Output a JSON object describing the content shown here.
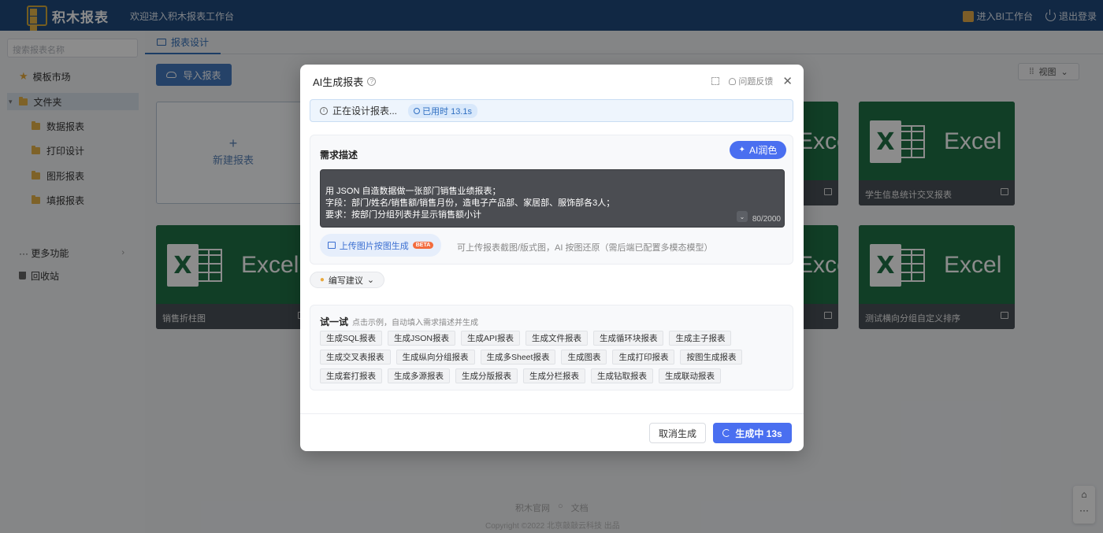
{
  "header": {
    "logo_text": "积木报表",
    "welcome": "欢迎进入积木报表工作台",
    "bi_link": "进入BI工作台",
    "logout": "退出登录"
  },
  "sidebar": {
    "search_placeholder": "搜索报表名称",
    "template_market": "模板市场",
    "folder": "文件夹",
    "sub_items": [
      "数据报表",
      "打印设计",
      "图形报表",
      "填报报表"
    ],
    "more": "··· 更多功能",
    "recycle": "回收站"
  },
  "main": {
    "tab": "报表设计",
    "import_btn": "导入报表",
    "view_btn": "视图",
    "new_card": "新建报表",
    "excel_word": "Excel",
    "cards": [
      {
        "title": ""
      },
      {
        "title": "学生信息统计交叉报表"
      },
      {
        "title": "销售折柱图"
      },
      {
        "title": ""
      },
      {
        "title": "测试横向分组自定义排序"
      }
    ],
    "footer_links": [
      "积木官网",
      "文档"
    ],
    "copyright": "Copyright ©2022 北京敲敲云科技 出品"
  },
  "modal": {
    "title": "AI生成报表",
    "feedback": "问题反馈",
    "status_text": "正在设计报表...",
    "elapsed": "已用时 13.1s",
    "req_title": "需求描述",
    "ai_polish": "AI润色",
    "textarea_value": "用 JSON 自造数据做一张部门销售业绩报表；\n字段：部门/姓名/销售额/销售月份，造电子产品部、家居部、服饰部各3人；\n要求：按部门分组列表并显示销售额小计",
    "char_count": "80/2000",
    "upload_btn": "上传图片按图生成",
    "beta": "BETA",
    "upload_hint": "可上传报表截图/版式图，AI 按图还原（需后端已配置多模态模型）",
    "suggest_btn": "编写建议",
    "try_title": "试一试",
    "try_hint": "点击示例，自动填入需求描述并生成",
    "chips": [
      "生成SQL报表",
      "生成JSON报表",
      "生成API报表",
      "生成文件报表",
      "生成循环块报表",
      "生成主子报表",
      "生成交叉表报表",
      "生成纵向分组报表",
      "生成多Sheet报表",
      "生成图表",
      "生成打印报表",
      "按图生成报表",
      "生成套打报表",
      "生成多源报表",
      "生成分版报表",
      "生成分栏报表",
      "生成钻取报表",
      "生成联动报表"
    ],
    "cancel": "取消生成",
    "generating": "生成中 13s"
  }
}
